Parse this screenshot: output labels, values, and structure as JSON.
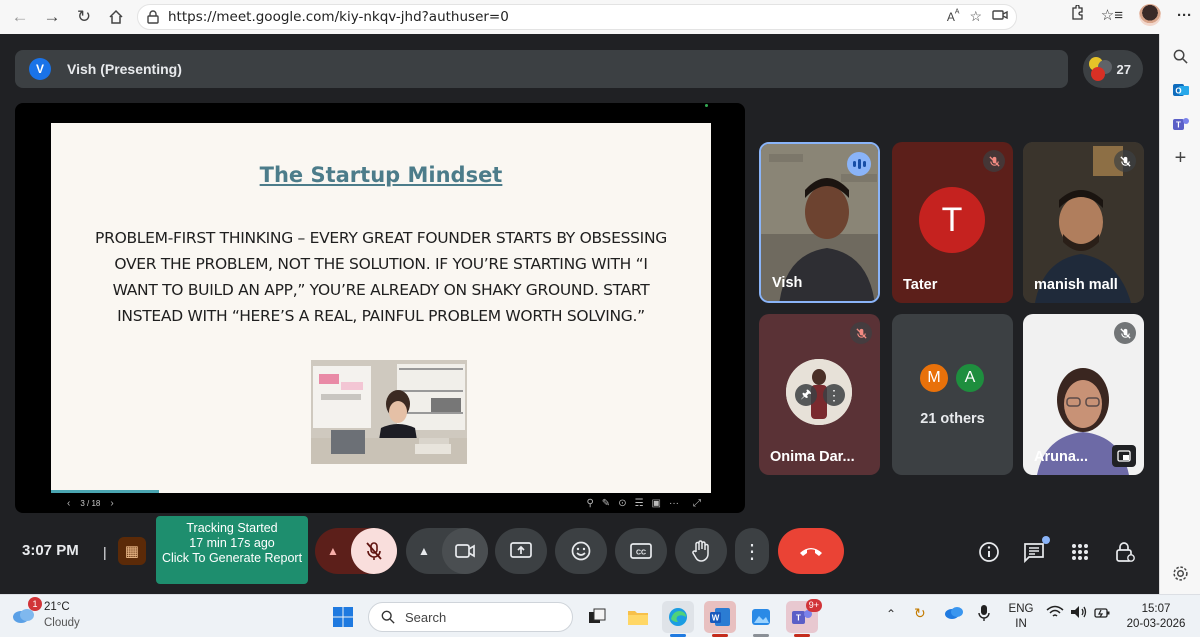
{
  "browser": {
    "url": "https://meet.google.com/kiy-nkqv-jhd?authuser=0"
  },
  "meet": {
    "presenter_initial": "V",
    "presenting_label": "Vish (Presenting)",
    "people_count": "27"
  },
  "slide": {
    "title": "The Startup Mindset",
    "body": "Problem-first thinking – Every great founder starts by obsessing over the problem, not the solution. If you’re starting with “I want to build an app,” you’re already on shaky ground. Start instead with “Here’s a real, painful problem worth solving.”",
    "page": "3 / 18"
  },
  "tiles": [
    {
      "name": "Vish",
      "state": "speaking"
    },
    {
      "name": "Tater",
      "initial": "T",
      "state": "muted"
    },
    {
      "name": "manish mall",
      "state": "muted"
    },
    {
      "name": "Onima Dar...",
      "state": "muted"
    },
    {
      "name": "21 others",
      "avatars": [
        "M",
        "A"
      ]
    },
    {
      "name": "Aruna...",
      "state": "muted"
    }
  ],
  "controls": {
    "time": "3:07 PM",
    "tracking_line1": "Tracking Started",
    "tracking_line2": "17 min 17s ago",
    "tracking_line3": "Click To Generate Report"
  },
  "taskbar": {
    "temperature": "21°C",
    "condition": "Cloudy",
    "weather_badge": "1",
    "search_placeholder": "Search",
    "teams_badge": "9+",
    "lang_top": "ENG",
    "lang_bottom": "IN",
    "clock_time": "15:07",
    "clock_date": "20-03-2026"
  },
  "colors": {
    "meet_bg": "#202124",
    "tile_bg": "#3c4043",
    "end_call": "#ea4335",
    "mic_off_btn": "#f9dedc",
    "tracking": "#1e8e6e",
    "slide_title": "#4c7c8a"
  }
}
